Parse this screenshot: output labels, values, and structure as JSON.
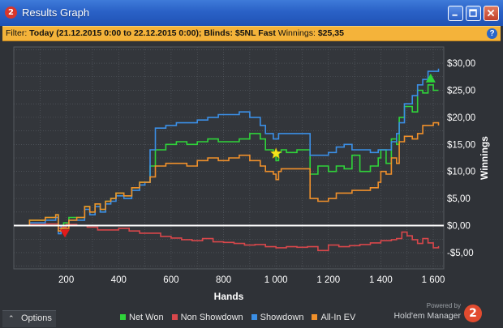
{
  "window": {
    "title": "Results Graph",
    "app_icon": "2",
    "buttons": [
      "minimize",
      "maximize",
      "close"
    ]
  },
  "filter": {
    "prefix": "Filter:",
    "period": "Today (21.12.2015 0:00 to 22.12.2015 0:00);",
    "blinds_label": "Blinds:",
    "blinds_value": "$5NL Fast",
    "winnings_label": "Winnings:",
    "winnings_value": "$25,35",
    "help": "?"
  },
  "options": {
    "label": "Options"
  },
  "brand": {
    "powered_by": "Powered by",
    "name": "Hold'em Manager",
    "logo": "2"
  },
  "colors": {
    "net_won": "#2fd43a",
    "non_showdown": "#d8474b",
    "showdown": "#3b8fe6",
    "all_in_ev": "#f0902b",
    "background": "#2f3237",
    "filter_bar": "#f4b33a",
    "zero_line": "#ffffff",
    "grid": "#5a5f66"
  },
  "chart_data": {
    "type": "line",
    "xlabel": "Hands",
    "ylabel": "Winnings",
    "xlim": [
      0,
      1640
    ],
    "ylim": [
      -8,
      33
    ],
    "x_ticks": [
      200,
      400,
      600,
      800,
      1000,
      1200,
      1400,
      1600
    ],
    "x_tick_labels": [
      "200",
      "400",
      "600",
      "800",
      "1 000",
      "1 200",
      "1 400",
      "1 600"
    ],
    "y_ticks": [
      -5,
      0,
      5,
      10,
      15,
      20,
      25,
      30
    ],
    "y_tick_labels": [
      "-$5,00",
      "$0,00",
      "$5,00",
      "$10,00",
      "$15,00",
      "$20,00",
      "$25,00",
      "$30,00"
    ],
    "grid": true,
    "legend_position": "bottom",
    "series": [
      {
        "name": "Net Won",
        "color": "#2fd43a",
        "x": [
          0,
          60,
          120,
          160,
          170,
          180,
          190,
          210,
          240,
          270,
          290,
          310,
          330,
          350,
          370,
          390,
          420,
          450,
          480,
          500,
          520,
          540,
          580,
          620,
          660,
          700,
          740,
          780,
          820,
          860,
          900,
          940,
          960,
          990,
          1000,
          1010,
          1020,
          1040,
          1080,
          1120,
          1130,
          1160,
          1200,
          1230,
          1260,
          1290,
          1320,
          1360,
          1390,
          1400,
          1420,
          1440,
          1460,
          1470,
          1490,
          1520,
          1540,
          1560,
          1580,
          1600,
          1620
        ],
        "y": [
          0,
          1,
          1.5,
          2,
          -1,
          -0.5,
          0.5,
          1.5,
          1.5,
          3.5,
          2.5,
          4,
          3,
          4.5,
          5,
          6,
          5.5,
          7,
          8,
          8,
          11,
          14,
          15,
          15.5,
          15,
          15.5,
          16,
          15.5,
          15.5,
          16,
          17,
          16,
          14,
          13.5,
          12,
          13.5,
          14,
          13.5,
          14,
          14,
          9.5,
          11,
          10,
          11,
          10.5,
          13,
          10,
          11,
          12.5,
          14,
          11.5,
          16,
          15,
          20,
          22,
          21,
          25,
          24.5,
          26,
          25,
          25
        ]
      },
      {
        "name": "Non Showdown",
        "color": "#d8474b",
        "x": [
          0,
          60,
          120,
          160,
          170,
          180,
          200,
          240,
          280,
          320,
          360,
          400,
          440,
          480,
          520,
          560,
          600,
          640,
          680,
          720,
          760,
          800,
          840,
          880,
          920,
          960,
          1000,
          1040,
          1080,
          1120,
          1160,
          1200,
          1240,
          1280,
          1320,
          1360,
          1400,
          1440,
          1460,
          1480,
          1500,
          1520,
          1540,
          1560,
          1580,
          1600,
          1620
        ],
        "y": [
          0,
          0.2,
          0.3,
          0.3,
          -0.5,
          -0.3,
          0.2,
          0,
          -0.3,
          -0.8,
          -0.8,
          -0.5,
          -1,
          -1.4,
          -1.4,
          -2,
          -2.3,
          -2.6,
          -2.8,
          -2.4,
          -3,
          -3.1,
          -3.3,
          -3.6,
          -3.5,
          -3.9,
          -4.1,
          -3.9,
          -4,
          -3.9,
          -4.6,
          -3.6,
          -3.9,
          -3.7,
          -3.5,
          -3.2,
          -2.8,
          -2.6,
          -2.4,
          -1.2,
          -1.9,
          -2.6,
          -3.3,
          -2.4,
          -3.2,
          -4.1,
          -3.8
        ]
      },
      {
        "name": "Showdown",
        "color": "#3b8fe6",
        "x": [
          0,
          60,
          120,
          160,
          170,
          180,
          210,
          240,
          270,
          290,
          310,
          330,
          350,
          370,
          390,
          420,
          450,
          480,
          500,
          520,
          540,
          580,
          620,
          660,
          700,
          740,
          780,
          820,
          860,
          900,
          940,
          960,
          990,
          1000,
          1010,
          1020,
          1040,
          1080,
          1120,
          1130,
          1160,
          1200,
          1230,
          1260,
          1290,
          1320,
          1360,
          1390,
          1400,
          1420,
          1440,
          1460,
          1470,
          1490,
          1520,
          1540,
          1560,
          1580,
          1600,
          1620
        ],
        "y": [
          0,
          0.5,
          1,
          1.5,
          -1.5,
          0,
          1,
          1,
          3,
          2,
          3.5,
          2.5,
          4,
          4.5,
          5.5,
          5,
          6.5,
          7.5,
          8,
          14,
          18,
          18.5,
          19,
          19,
          19.5,
          20,
          20.5,
          20.5,
          21,
          20,
          18.5,
          17,
          16,
          16,
          17,
          17,
          17,
          17,
          17,
          13,
          13,
          13.5,
          14.5,
          15,
          14,
          14,
          13.5,
          14,
          14,
          14,
          15.5,
          17,
          19,
          22.5,
          24,
          26,
          27,
          28.5,
          28.5,
          29
        ]
      },
      {
        "name": "All-In EV",
        "color": "#f0902b",
        "x": [
          0,
          60,
          120,
          160,
          170,
          180,
          210,
          240,
          270,
          290,
          310,
          330,
          350,
          370,
          390,
          420,
          450,
          480,
          500,
          520,
          540,
          580,
          620,
          660,
          700,
          740,
          780,
          820,
          860,
          900,
          940,
          960,
          990,
          1000,
          1010,
          1020,
          1040,
          1080,
          1120,
          1130,
          1160,
          1200,
          1230,
          1260,
          1290,
          1320,
          1360,
          1390,
          1400,
          1420,
          1440,
          1460,
          1470,
          1490,
          1520,
          1540,
          1560,
          1580,
          1600,
          1620
        ],
        "y": [
          0,
          1,
          1.5,
          2,
          -1,
          -0.5,
          1,
          1.5,
          3.5,
          2.5,
          4,
          3,
          4.5,
          5,
          6,
          5.5,
          7,
          8,
          8,
          9,
          11,
          11.5,
          11.5,
          11,
          12,
          12.5,
          12,
          12.5,
          13,
          12,
          11,
          10,
          9.5,
          8.5,
          10,
          10.5,
          10.5,
          10.5,
          10.5,
          5,
          4.5,
          5,
          6,
          6,
          6.5,
          6.5,
          7,
          8,
          10,
          9.5,
          12.5,
          11.5,
          15.5,
          16.5,
          16,
          17,
          18.5,
          18.5,
          19,
          18.5
        ]
      }
    ],
    "markers": [
      {
        "type": "triangle-down",
        "color": "#e21b1b",
        "x": 195,
        "y": -1.3
      },
      {
        "type": "star",
        "color": "#f5e31c",
        "x": 1000,
        "y": 13.3
      },
      {
        "type": "triangle-up",
        "color": "#2fd43a",
        "x": 1590,
        "y": 27.2
      }
    ]
  }
}
